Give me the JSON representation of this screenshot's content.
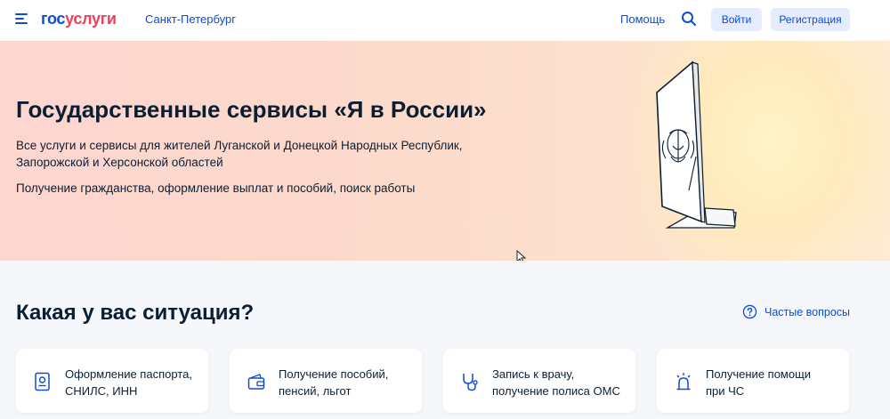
{
  "header": {
    "logo_part1": "гос",
    "logo_part2": "услуги",
    "city": "Санкт-Петербург",
    "help": "Помощь",
    "login": "Войти",
    "register": "Регистрация"
  },
  "hero": {
    "title": "Государственные сервисы «Я в России»",
    "subtitle_line1": "Все услуги и сервисы для жителей Луганской и Донецкой Народных Республик,",
    "subtitle_line2": "Запорожской и Херсонской областей",
    "subtitle2": "Получение гражданства, оформление выплат и пособий, поиск работы"
  },
  "situations": {
    "title": "Какая у вас ситуация?",
    "faq": "Частые вопросы",
    "cards": [
      {
        "line1": "Оформление паспорта,",
        "line2": "СНИЛС, ИНН",
        "icon": "passport-icon"
      },
      {
        "line1": "Получение пособий,",
        "line2": "пенсий, льгот",
        "icon": "wallet-icon"
      },
      {
        "line1": "Запись к врачу,",
        "line2": "получение полиса ОМС",
        "icon": "stethoscope-icon"
      },
      {
        "line1": "Получение помощи",
        "line2": "при ЧС",
        "icon": "alarm-icon"
      }
    ]
  },
  "colors": {
    "brand_blue": "#0d4cd3",
    "brand_red": "#ee3f58",
    "text": "#0b1f33",
    "button_bg": "#e4ecfd"
  }
}
